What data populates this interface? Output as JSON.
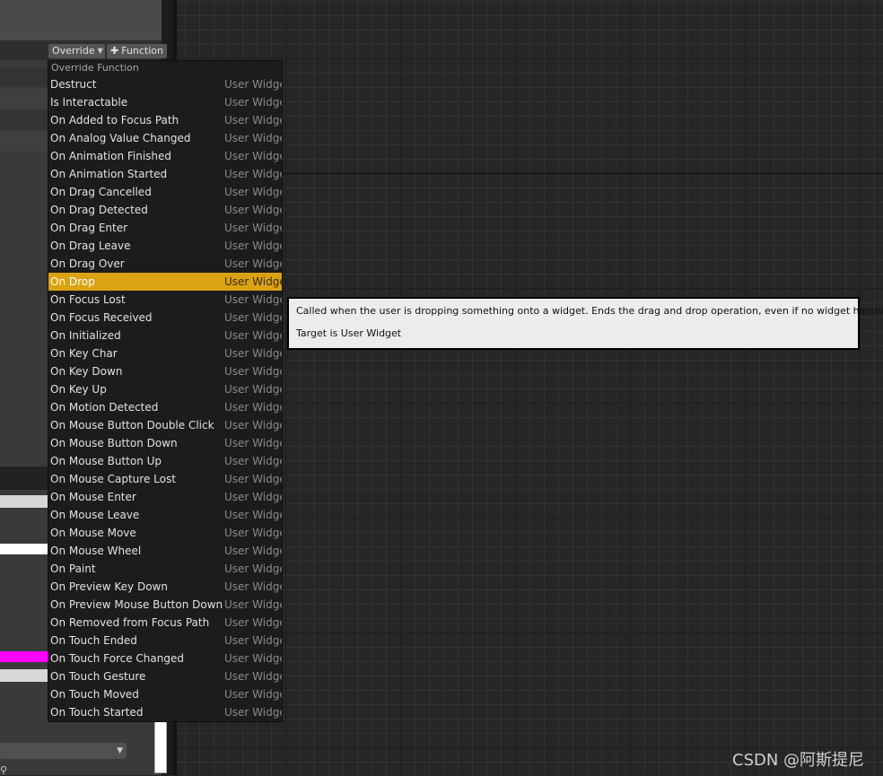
{
  "toolbar": {
    "override_label": "Override",
    "function_label": "Function"
  },
  "menu": {
    "header": "Override Function",
    "selected": "On Drop",
    "items": [
      {
        "label": "Destruct",
        "category": "User Widget"
      },
      {
        "label": "Is Interactable",
        "category": "User Widget"
      },
      {
        "label": "On Added to Focus Path",
        "category": "User Widget"
      },
      {
        "label": "On Analog Value Changed",
        "category": "User Widget"
      },
      {
        "label": "On Animation Finished",
        "category": "User Widget"
      },
      {
        "label": "On Animation Started",
        "category": "User Widget"
      },
      {
        "label": "On Drag Cancelled",
        "category": "User Widget"
      },
      {
        "label": "On Drag Detected",
        "category": "User Widget"
      },
      {
        "label": "On Drag Enter",
        "category": "User Widget"
      },
      {
        "label": "On Drag Leave",
        "category": "User Widget"
      },
      {
        "label": "On Drag Over",
        "category": "User Widget"
      },
      {
        "label": "On Drop",
        "category": "User Widget"
      },
      {
        "label": "On Focus Lost",
        "category": "User Widget"
      },
      {
        "label": "On Focus Received",
        "category": "User Widget"
      },
      {
        "label": "On Initialized",
        "category": "User Widget"
      },
      {
        "label": "On Key Char",
        "category": "User Widget"
      },
      {
        "label": "On Key Down",
        "category": "User Widget"
      },
      {
        "label": "On Key Up",
        "category": "User Widget"
      },
      {
        "label": "On Motion Detected",
        "category": "User Widget"
      },
      {
        "label": "On Mouse Button Double Click",
        "category": "User Widget"
      },
      {
        "label": "On Mouse Button Down",
        "category": "User Widget"
      },
      {
        "label": "On Mouse Button Up",
        "category": "User Widget"
      },
      {
        "label": "On Mouse Capture Lost",
        "category": "User Widget"
      },
      {
        "label": "On Mouse Enter",
        "category": "User Widget"
      },
      {
        "label": "On Mouse Leave",
        "category": "User Widget"
      },
      {
        "label": "On Mouse Move",
        "category": "User Widget"
      },
      {
        "label": "On Mouse Wheel",
        "category": "User Widget"
      },
      {
        "label": "On Paint",
        "category": "User Widget"
      },
      {
        "label": "On Preview Key Down",
        "category": "User Widget"
      },
      {
        "label": "On Preview Mouse Button Down",
        "category": "User Widget"
      },
      {
        "label": "On Removed from Focus Path",
        "category": "User Widget"
      },
      {
        "label": "On Touch Ended",
        "category": "User Widget"
      },
      {
        "label": "On Touch Force Changed",
        "category": "User Widget"
      },
      {
        "label": "On Touch Gesture",
        "category": "User Widget"
      },
      {
        "label": "On Touch Moved",
        "category": "User Widget"
      },
      {
        "label": "On Touch Started",
        "category": "User Widget"
      }
    ]
  },
  "tooltip": {
    "line1": "Called when the user is dropping something onto a widget.  Ends the drag and drop operation, even if no widget handles this.",
    "line2": "Target is User Widget"
  },
  "colors": {
    "highlight": "#dba314",
    "magenta_swatch": "#ff00ff"
  },
  "left_panel": {
    "search_icon": "search-icon"
  },
  "watermark": "CSDN @阿斯提尼"
}
